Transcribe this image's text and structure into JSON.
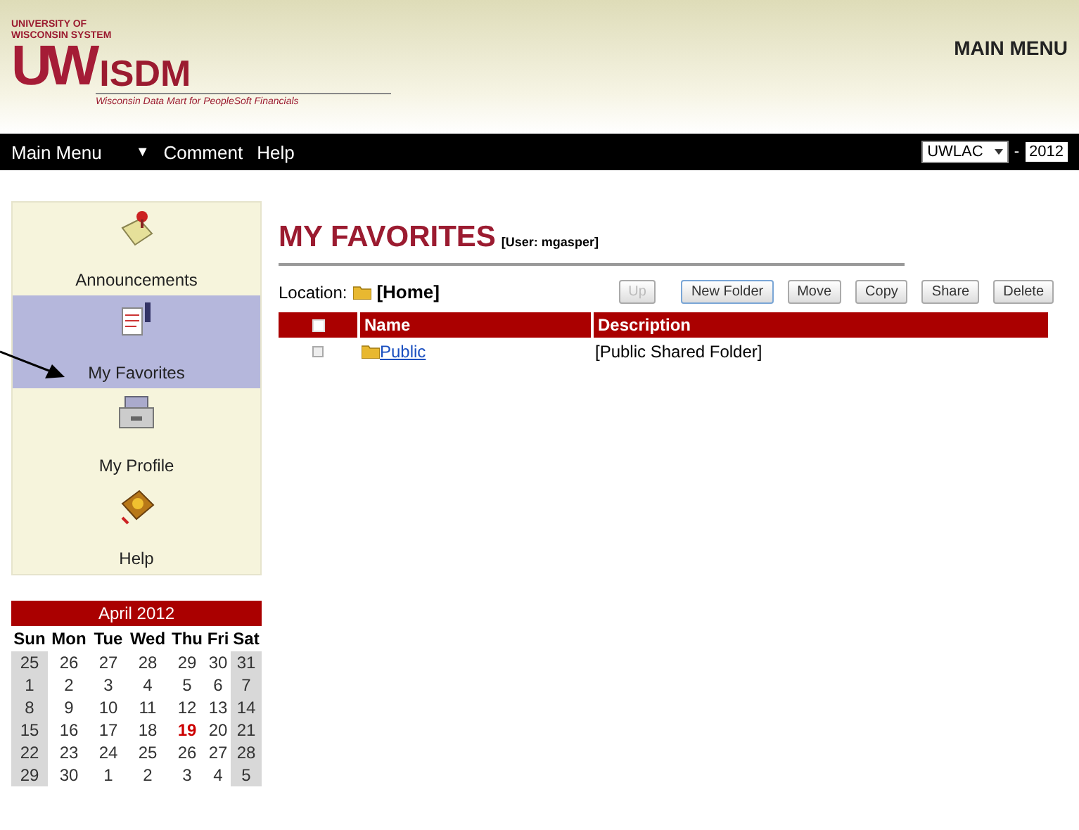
{
  "header": {
    "logo": {
      "line_1": "UNIVERSITY OF",
      "line_2": "WISCONSIN SYSTEM",
      "mark": "UW",
      "name": "ISDM",
      "tagline": "Wisconsin Data Mart for PeopleSoft Financials"
    },
    "title": "MAIN MENU"
  },
  "menu_bar": {
    "items": [
      {
        "label": "Main Menu"
      },
      {
        "label": "▼"
      },
      {
        "label": "Comment"
      },
      {
        "label": "Help"
      }
    ],
    "institution": "UWLAC",
    "separator": "-",
    "year": "2012"
  },
  "sidebar": {
    "items": [
      {
        "label": "Announcements",
        "kind": "note",
        "selected": false
      },
      {
        "label": "My Favorites",
        "kind": "favorites",
        "selected": true
      },
      {
        "label": "My Profile",
        "kind": "profile",
        "selected": false
      },
      {
        "label": "Help",
        "kind": "help",
        "selected": false
      }
    ]
  },
  "calendar": {
    "title": "April 2012",
    "weekdays": [
      "Sun",
      "Mon",
      "Tue",
      "Wed",
      "Thu",
      "Fri",
      "Sat"
    ],
    "weeks": [
      [
        {
          "day": "25",
          "today": false
        },
        {
          "day": "26",
          "today": false
        },
        {
          "day": "27",
          "today": false
        },
        {
          "day": "28",
          "today": false
        },
        {
          "day": "29",
          "today": false
        },
        {
          "day": "30",
          "today": false
        },
        {
          "day": "31",
          "today": false
        }
      ],
      [
        {
          "day": "1",
          "today": false
        },
        {
          "day": "2",
          "today": false
        },
        {
          "day": "3",
          "today": false
        },
        {
          "day": "4",
          "today": false
        },
        {
          "day": "5",
          "today": false
        },
        {
          "day": "6",
          "today": false
        },
        {
          "day": "7",
          "today": false
        }
      ],
      [
        {
          "day": "8",
          "today": false
        },
        {
          "day": "9",
          "today": false
        },
        {
          "day": "10",
          "today": false
        },
        {
          "day": "11",
          "today": false
        },
        {
          "day": "12",
          "today": false
        },
        {
          "day": "13",
          "today": false
        },
        {
          "day": "14",
          "today": false
        }
      ],
      [
        {
          "day": "15",
          "today": false
        },
        {
          "day": "16",
          "today": false
        },
        {
          "day": "17",
          "today": false
        },
        {
          "day": "18",
          "today": false
        },
        {
          "day": "19",
          "today": true
        },
        {
          "day": "20",
          "today": false
        },
        {
          "day": "21",
          "today": false
        }
      ],
      [
        {
          "day": "22",
          "today": false
        },
        {
          "day": "23",
          "today": false
        },
        {
          "day": "24",
          "today": false
        },
        {
          "day": "25",
          "today": false
        },
        {
          "day": "26",
          "today": false
        },
        {
          "day": "27",
          "today": false
        },
        {
          "day": "28",
          "today": false
        }
      ],
      [
        {
          "day": "29",
          "today": false
        },
        {
          "day": "30",
          "today": false
        },
        {
          "day": "1",
          "today": false
        },
        {
          "day": "2",
          "today": false
        },
        {
          "day": "3",
          "today": false
        },
        {
          "day": "4",
          "today": false
        },
        {
          "day": "5",
          "today": false
        }
      ]
    ]
  },
  "favorites": {
    "title": "MY FAVORITES",
    "user": "[User: mgasper]",
    "location_label": "Location:",
    "location": "[Home]",
    "buttons": [
      {
        "label": "Up",
        "disabled": true,
        "selected": false
      },
      {
        "label": "New Folder",
        "disabled": false,
        "selected": true
      },
      {
        "label": "Move",
        "disabled": false,
        "selected": false
      },
      {
        "label": "Copy",
        "disabled": false,
        "selected": false
      },
      {
        "label": "Share",
        "disabled": false,
        "selected": false
      },
      {
        "label": "Delete",
        "disabled": false,
        "selected": false
      }
    ],
    "select_all_checked": false,
    "columns": [
      "Name",
      "Description"
    ],
    "rows": [
      {
        "name": "Public",
        "description": "[Public Shared Folder]",
        "checked": false
      }
    ]
  }
}
